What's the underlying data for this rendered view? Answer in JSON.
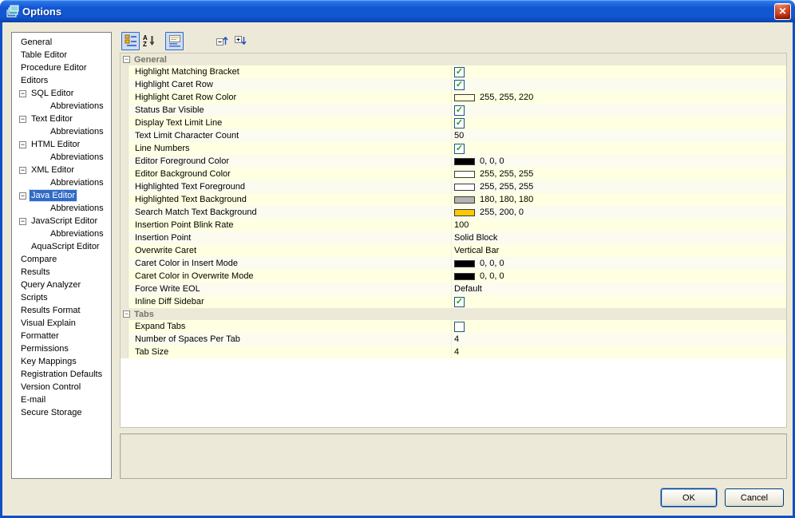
{
  "window": {
    "title": "Options"
  },
  "icons": {
    "close": "✕",
    "minus": "−",
    "check": "✓"
  },
  "colors": {
    "panel_bg": "#ece9d8",
    "selection_blue": "#316ac5",
    "border_blue": "#1050c8",
    "row_odd": "#ffffe1",
    "row_even": "#fbfbef",
    "check_green": "#21a121"
  },
  "sidebar": {
    "items": [
      {
        "label": "General",
        "indent": 0
      },
      {
        "label": "Table Editor",
        "indent": 0
      },
      {
        "label": "Procedure Editor",
        "indent": 0
      },
      {
        "label": "Editors",
        "indent": 0
      },
      {
        "label": "SQL Editor",
        "indent": 1,
        "expander": true
      },
      {
        "label": "Abbreviations",
        "indent": 2
      },
      {
        "label": "Text Editor",
        "indent": 1,
        "expander": true
      },
      {
        "label": "Abbreviations",
        "indent": 2
      },
      {
        "label": "HTML Editor",
        "indent": 1,
        "expander": true
      },
      {
        "label": "Abbreviations",
        "indent": 2
      },
      {
        "label": "XML Editor",
        "indent": 1,
        "expander": true
      },
      {
        "label": "Abbreviations",
        "indent": 2
      },
      {
        "label": "Java Editor",
        "indent": 1,
        "expander": true,
        "selected": true
      },
      {
        "label": "Abbreviations",
        "indent": 2
      },
      {
        "label": "JavaScript Editor",
        "indent": 1,
        "expander": true
      },
      {
        "label": "Abbreviations",
        "indent": 2
      },
      {
        "label": "AquaScript Editor",
        "indent": 1
      },
      {
        "label": "Compare",
        "indent": 0
      },
      {
        "label": "Results",
        "indent": 0
      },
      {
        "label": "Query Analyzer",
        "indent": 0
      },
      {
        "label": "Scripts",
        "indent": 0
      },
      {
        "label": "Results Format",
        "indent": 0
      },
      {
        "label": "Visual Explain",
        "indent": 0
      },
      {
        "label": "Formatter",
        "indent": 0
      },
      {
        "label": "Permissions",
        "indent": 0
      },
      {
        "label": "Key Mappings",
        "indent": 0
      },
      {
        "label": "Registration Defaults",
        "indent": 0
      },
      {
        "label": "Version Control",
        "indent": 0
      },
      {
        "label": "E-mail",
        "indent": 0
      },
      {
        "label": "Secure Storage",
        "indent": 0
      }
    ]
  },
  "toolbar": {
    "buttons": [
      "categorized-view",
      "sort-alphabetical",
      "show-description",
      "collapse-all",
      "expand-all"
    ]
  },
  "grid": {
    "sections": [
      {
        "title": "General",
        "rows": [
          {
            "label": "Highlight Matching Bracket",
            "type": "checkbox",
            "checked": true
          },
          {
            "label": "Highlight Caret Row",
            "type": "checkbox",
            "checked": true
          },
          {
            "label": "Highlight Caret Row Color",
            "type": "color",
            "swatch": "#FFFFDC",
            "value": "255, 255, 220"
          },
          {
            "label": "Status Bar Visible",
            "type": "checkbox",
            "checked": true
          },
          {
            "label": "Display Text Limit Line",
            "type": "checkbox",
            "checked": true
          },
          {
            "label": "Text Limit Character Count",
            "type": "text",
            "value": "50"
          },
          {
            "label": "Line Numbers",
            "type": "checkbox",
            "checked": true
          },
          {
            "label": "Editor Foreground Color",
            "type": "color",
            "swatch": "#000000",
            "value": "0, 0, 0"
          },
          {
            "label": "Editor Background Color",
            "type": "color",
            "swatch": "#FFFFFF",
            "value": "255, 255, 255"
          },
          {
            "label": "Highlighted Text Foreground",
            "type": "color",
            "swatch": "#FFFFFF",
            "value": "255, 255, 255"
          },
          {
            "label": "Highlighted Text Background",
            "type": "color",
            "swatch": "#B4B4B4",
            "value": "180, 180, 180"
          },
          {
            "label": "Search Match Text Background",
            "type": "color",
            "swatch": "#FFC800",
            "value": "255, 200, 0"
          },
          {
            "label": "Insertion Point Blink Rate",
            "type": "text",
            "value": "100"
          },
          {
            "label": "Insertion Point",
            "type": "text",
            "value": "Solid Block"
          },
          {
            "label": "Overwrite Caret",
            "type": "text",
            "value": "Vertical Bar"
          },
          {
            "label": "Caret Color in Insert Mode",
            "type": "color",
            "swatch": "#000000",
            "value": "0, 0, 0"
          },
          {
            "label": "Caret Color in Overwrite Mode",
            "type": "color",
            "swatch": "#000000",
            "value": "0, 0, 0"
          },
          {
            "label": "Force Write EOL",
            "type": "text",
            "value": "Default"
          },
          {
            "label": "Inline Diff Sidebar",
            "type": "checkbox",
            "checked": true
          }
        ]
      },
      {
        "title": "Tabs",
        "rows": [
          {
            "label": "Expand Tabs",
            "type": "checkbox",
            "checked": false
          },
          {
            "label": "Number of Spaces Per Tab",
            "type": "text",
            "value": "4"
          },
          {
            "label": "Tab Size",
            "type": "text",
            "value": "4"
          }
        ]
      }
    ]
  },
  "buttons": {
    "ok": "OK",
    "cancel": "Cancel"
  }
}
